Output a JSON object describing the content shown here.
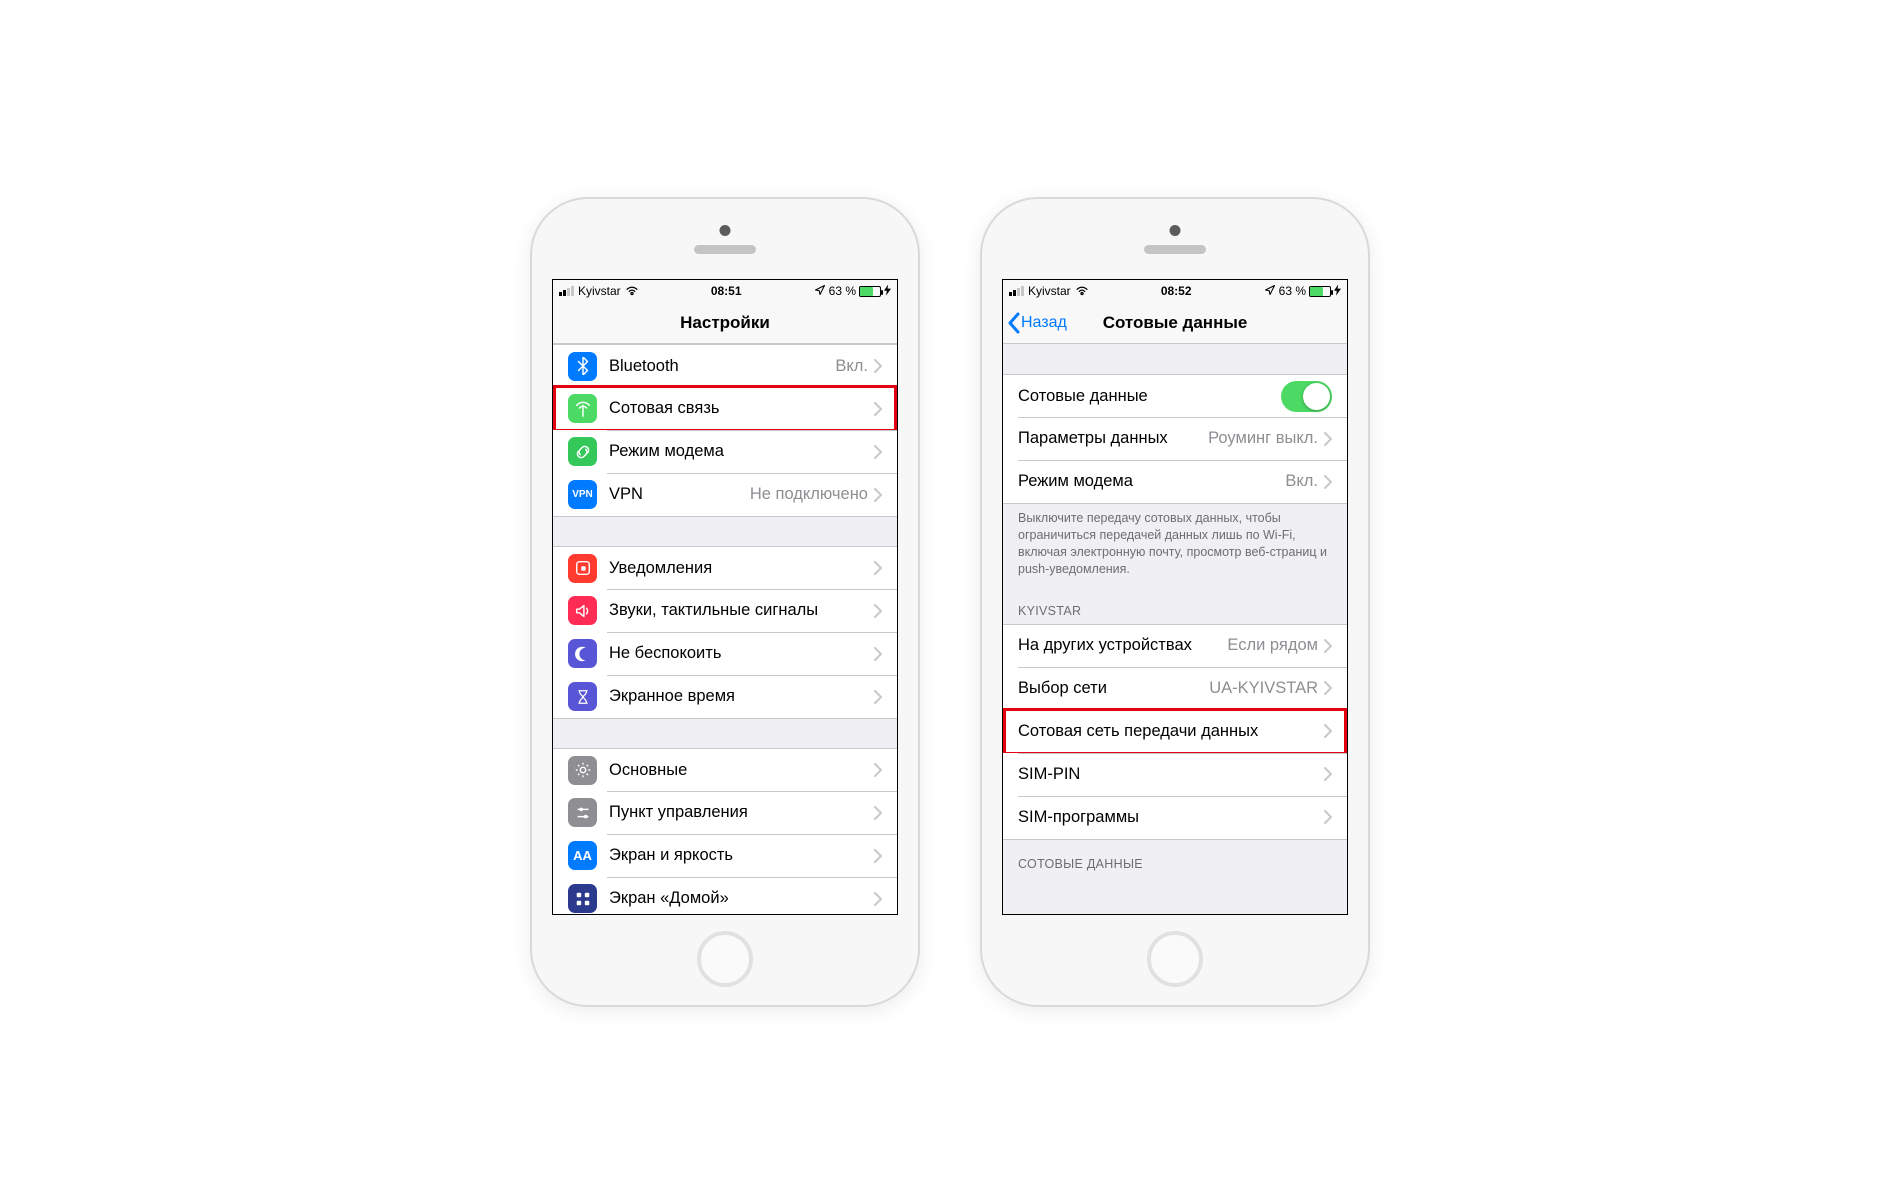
{
  "phone1": {
    "status": {
      "carrier": "Kyivstar",
      "time": "08:51",
      "battery_pct": "63 %",
      "battery_fill": 63
    },
    "nav": {
      "title": "Настройки"
    },
    "g1": {
      "bluetooth": {
        "label": "Bluetooth",
        "detail": "Вкл."
      },
      "cellular": {
        "label": "Сотовая связь"
      },
      "hotspot": {
        "label": "Режим модема"
      },
      "vpn": {
        "label": "VPN",
        "detail": "Не подключено",
        "badge": "VPN"
      }
    },
    "g2": {
      "notifications": {
        "label": "Уведомления"
      },
      "sounds": {
        "label": "Звуки, тактильные сигналы"
      },
      "dnd": {
        "label": "Не беспокоить"
      },
      "screentime": {
        "label": "Экранное время"
      }
    },
    "g3": {
      "general": {
        "label": "Основные"
      },
      "control": {
        "label": "Пункт управления"
      },
      "display": {
        "label": "Экран и яркость"
      },
      "homescreen": {
        "label": "Экран «Домой»"
      }
    }
  },
  "phone2": {
    "status": {
      "carrier": "Kyivstar",
      "time": "08:52",
      "battery_pct": "63 %",
      "battery_fill": 63
    },
    "nav": {
      "back": "Назад",
      "title": "Сотовые данные"
    },
    "sec1": {
      "cell_data": {
        "label": "Сотовые данные",
        "on": true
      },
      "data_params": {
        "label": "Параметры данных",
        "detail": "Роуминг выкл."
      },
      "hotspot": {
        "label": "Режим модема",
        "detail": "Вкл."
      }
    },
    "footer1": "Выключите передачу сотовых данных, чтобы ограничиться передачей данных лишь по Wi-Fi, включая электронную почту, просмотр веб-страниц и push-уведомления.",
    "header2": "KYIVSTAR",
    "sec2": {
      "other_devices": {
        "label": "На других устройствах",
        "detail": "Если рядом"
      },
      "network_sel": {
        "label": "Выбор сети",
        "detail": "UA-KYIVSTAR"
      },
      "cell_network": {
        "label": "Сотовая сеть передачи данных"
      },
      "sim_pin": {
        "label": "SIM-PIN"
      },
      "sim_apps": {
        "label": "SIM-программы"
      }
    },
    "header3": "СОТОВЫЕ ДАННЫЕ"
  }
}
